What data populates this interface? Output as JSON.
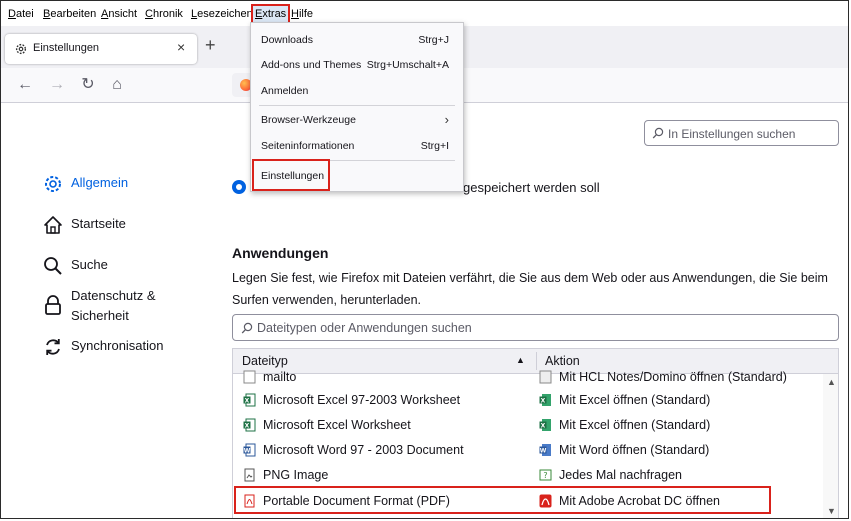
{
  "menubar": {
    "items": [
      {
        "label": "Datei",
        "accel": "D"
      },
      {
        "label": "Bearbeiten",
        "accel": "B"
      },
      {
        "label": "Ansicht",
        "accel": "A"
      },
      {
        "label": "Chronik",
        "accel": "C"
      },
      {
        "label": "Lesezeichen",
        "accel": "L"
      },
      {
        "label": "Extras",
        "accel": "E"
      },
      {
        "label": "Hilfe",
        "accel": "H"
      }
    ]
  },
  "tab": {
    "title": "Einstellungen",
    "close": "×"
  },
  "newtab": "+",
  "nav": {
    "back": "←",
    "forward": "→",
    "reload": "↻",
    "home": "⌂"
  },
  "settings_search": {
    "placeholder": "In Einstellungen suchen"
  },
  "sidebar": {
    "items": [
      {
        "label": "Allgemein",
        "icon": "gear-icon"
      },
      {
        "label": "Startseite",
        "icon": "home-icon"
      },
      {
        "label": "Suche",
        "icon": "search-icon"
      },
      {
        "label": "Datenschutz &",
        "label2": "Sicherheit",
        "icon": "lock-icon"
      },
      {
        "label": "Synchronisation",
        "icon": "sync-icon"
      }
    ]
  },
  "download_option": {
    "visible_text": "gespeichert werden soll"
  },
  "applications": {
    "heading": "Anwendungen",
    "desc_line1": "Legen Sie fest, wie Firefox mit Dateien verfährt, die Sie aus dem Web oder aus Anwendungen, die Sie beim",
    "desc_line2": "Surfen verwenden, herunterladen.",
    "search_placeholder": "Dateitypen oder Anwendungen suchen",
    "col_type": "Dateityp",
    "col_action": "Aktion",
    "sort_indicator": "▲",
    "rows": [
      {
        "type": "mailto",
        "action": "Mit HCL Notes/Domino öffnen (Standard)"
      },
      {
        "type": "Microsoft Excel 97-2003 Worksheet",
        "action": "Mit Excel öffnen (Standard)"
      },
      {
        "type": "Microsoft Excel Worksheet",
        "action": "Mit Excel öffnen (Standard)"
      },
      {
        "type": "Microsoft Word 97 - 2003 Document",
        "action": "Mit Word öffnen (Standard)"
      },
      {
        "type": "PNG Image",
        "action": "Jedes Mal nachfragen"
      },
      {
        "type": "Portable Document Format (PDF)",
        "action": "Mit Adobe Acrobat DC  öffnen"
      }
    ]
  },
  "extras_menu": {
    "items": [
      {
        "label": "Downloads",
        "shortcut": "Strg+J"
      },
      {
        "label": "Add-ons und Themes",
        "shortcut": "Strg+Umschalt+A"
      },
      {
        "label": "Anmelden",
        "shortcut": ""
      },
      {
        "label": "Browser-Werkzeuge",
        "shortcut": "",
        "submenu": "›"
      },
      {
        "label": "Seiteninformationen",
        "shortcut": "Strg+I"
      },
      {
        "label": "Einstellungen",
        "shortcut": ""
      }
    ]
  },
  "colors": {
    "accent": "#0061e0",
    "highlight": "#d9221b",
    "excel": "#1d7044",
    "word": "#2b579a",
    "pdf": "#d9221b"
  }
}
